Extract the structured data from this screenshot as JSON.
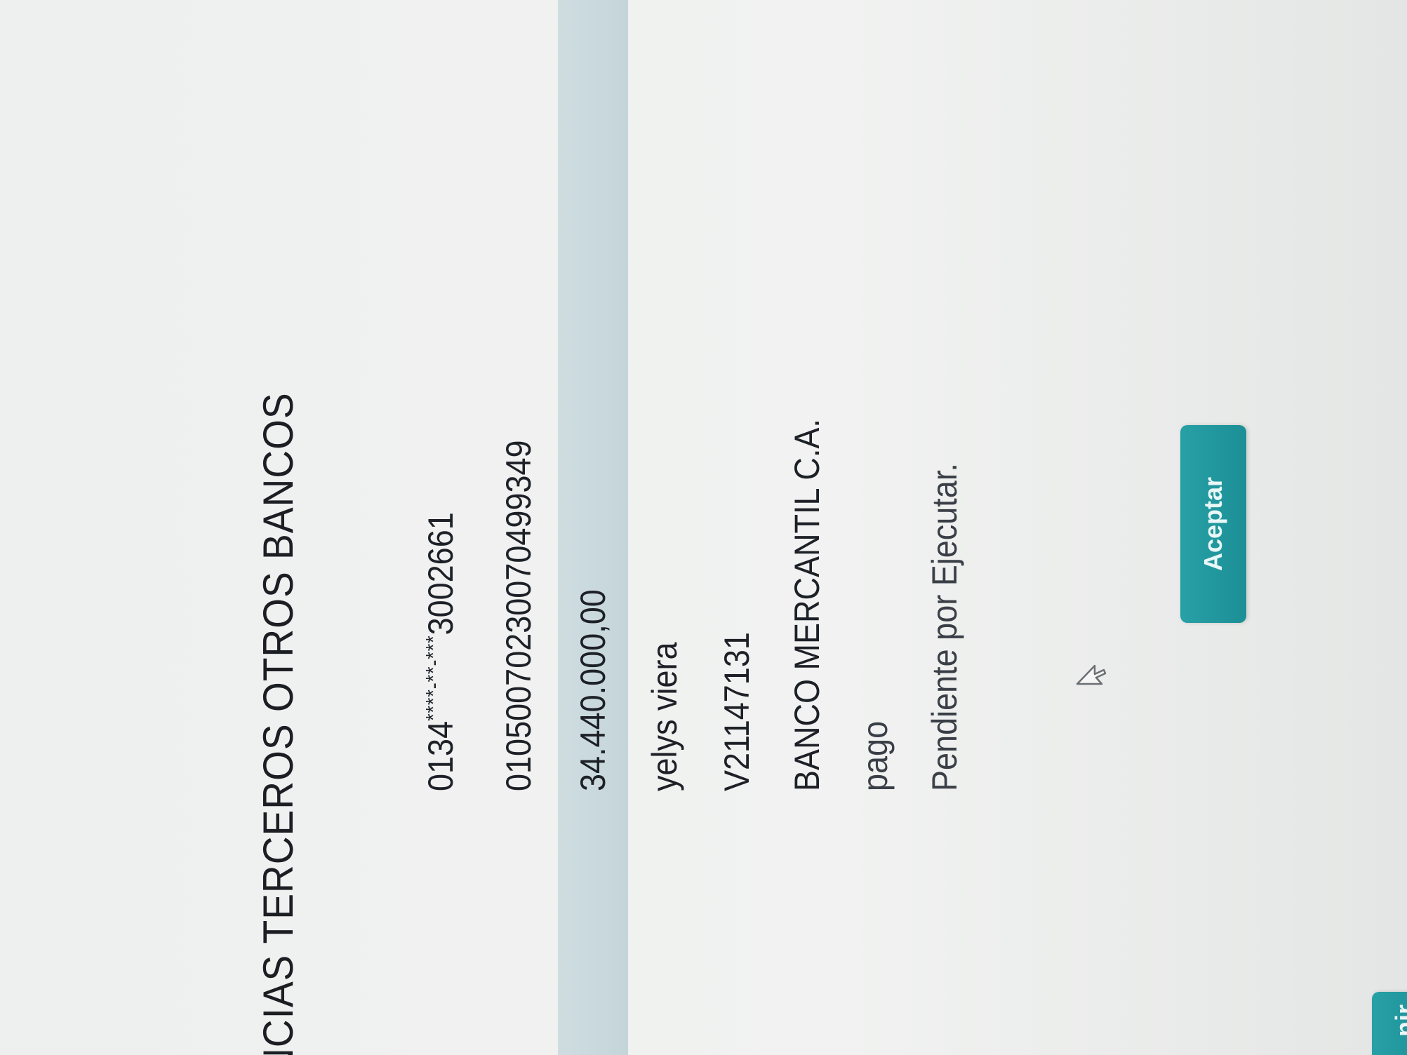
{
  "header": {
    "title": "NCIAS TERCEROS OTROS BANCOS"
  },
  "details": {
    "origin_account": {
      "prefix": "0134",
      "masked": "****-**-***",
      "suffix": "3002661"
    },
    "destination_account": "01050070230070499349",
    "amount": "34.440.000,00",
    "beneficiary_name": "yelys viera",
    "beneficiary_id": "V21147131",
    "bank": "BANCO MERCANTIL C.A.",
    "concept": "pago",
    "status": "Pendiente por Ejecutar."
  },
  "actions": {
    "accept_label": "Aceptar",
    "left_button_label": "nir"
  },
  "colors": {
    "accent": "#1f959b",
    "highlight_row": "#c8d8dc",
    "text": "#1c1f24"
  },
  "icons": {
    "cursor": "mouse-pointer-icon"
  }
}
